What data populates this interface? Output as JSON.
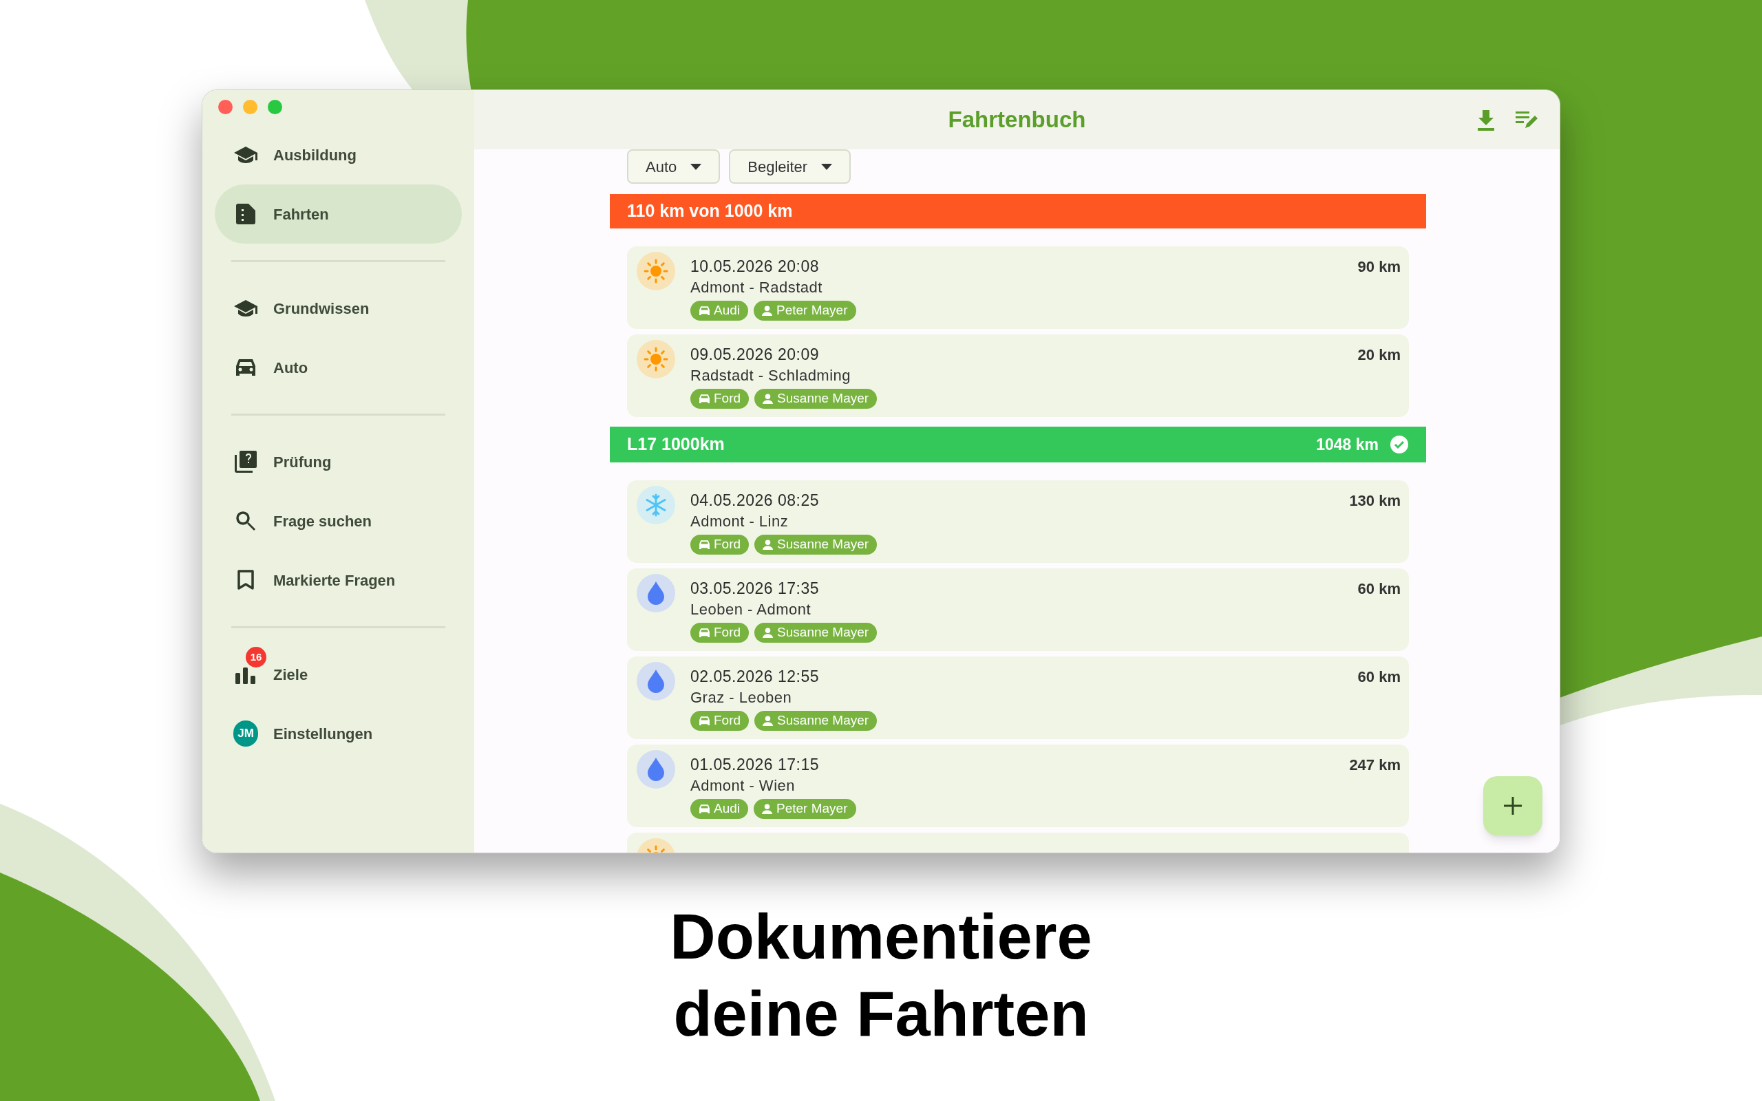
{
  "window": {
    "title": "Fahrtenbuch"
  },
  "sidebar": {
    "groups": [
      [
        {
          "label": "Ausbildung",
          "selected": false
        },
        {
          "label": "Fahrten",
          "selected": true
        }
      ],
      [
        {
          "label": "Grundwissen",
          "selected": false
        },
        {
          "label": "Auto",
          "selected": false
        }
      ],
      [
        {
          "label": "Prüfung",
          "selected": false
        },
        {
          "label": "Frage suchen",
          "selected": false
        },
        {
          "label": "Markierte Fragen",
          "selected": false
        }
      ],
      [
        {
          "label": "Ziele",
          "selected": false,
          "badge": "16"
        },
        {
          "label": "Einstellungen",
          "selected": false,
          "avatar": "JM"
        }
      ]
    ]
  },
  "filters": [
    {
      "label": "Auto"
    },
    {
      "label": "Begleiter"
    }
  ],
  "sections": [
    {
      "title": "110 km von 1000 km",
      "complete": false,
      "trips": [
        {
          "kind": "sun",
          "datetime": "10.05.2026 20:08",
          "route": "Admont - Radstadt",
          "distance": "90 km",
          "car": "Audi",
          "companion": "Peter Mayer"
        },
        {
          "kind": "sun",
          "datetime": "09.05.2026 20:09",
          "route": "Radstadt - Schladming",
          "distance": "20 km",
          "car": "Ford",
          "companion": "Susanne Mayer"
        }
      ]
    },
    {
      "title": "L17 1000km",
      "total": "1048 km",
      "complete": true,
      "trips": [
        {
          "kind": "snow",
          "datetime": "04.05.2026 08:25",
          "route": "Admont - Linz",
          "distance": "130 km",
          "car": "Ford",
          "companion": "Susanne Mayer"
        },
        {
          "kind": "rain",
          "datetime": "03.05.2026 17:35",
          "route": "Leoben - Admont",
          "distance": "60 km",
          "car": "Ford",
          "companion": "Susanne Mayer"
        },
        {
          "kind": "rain",
          "datetime": "02.05.2026 12:55",
          "route": "Graz - Leoben",
          "distance": "60 km",
          "car": "Ford",
          "companion": "Susanne Mayer"
        },
        {
          "kind": "rain",
          "datetime": "01.05.2026 17:15",
          "route": "Admont - Wien",
          "distance": "247 km",
          "car": "Audi",
          "companion": "Peter Mayer"
        },
        {
          "kind": "sun"
        }
      ]
    }
  ],
  "caption": [
    "Dokumentiere",
    "deine Fahrten"
  ]
}
